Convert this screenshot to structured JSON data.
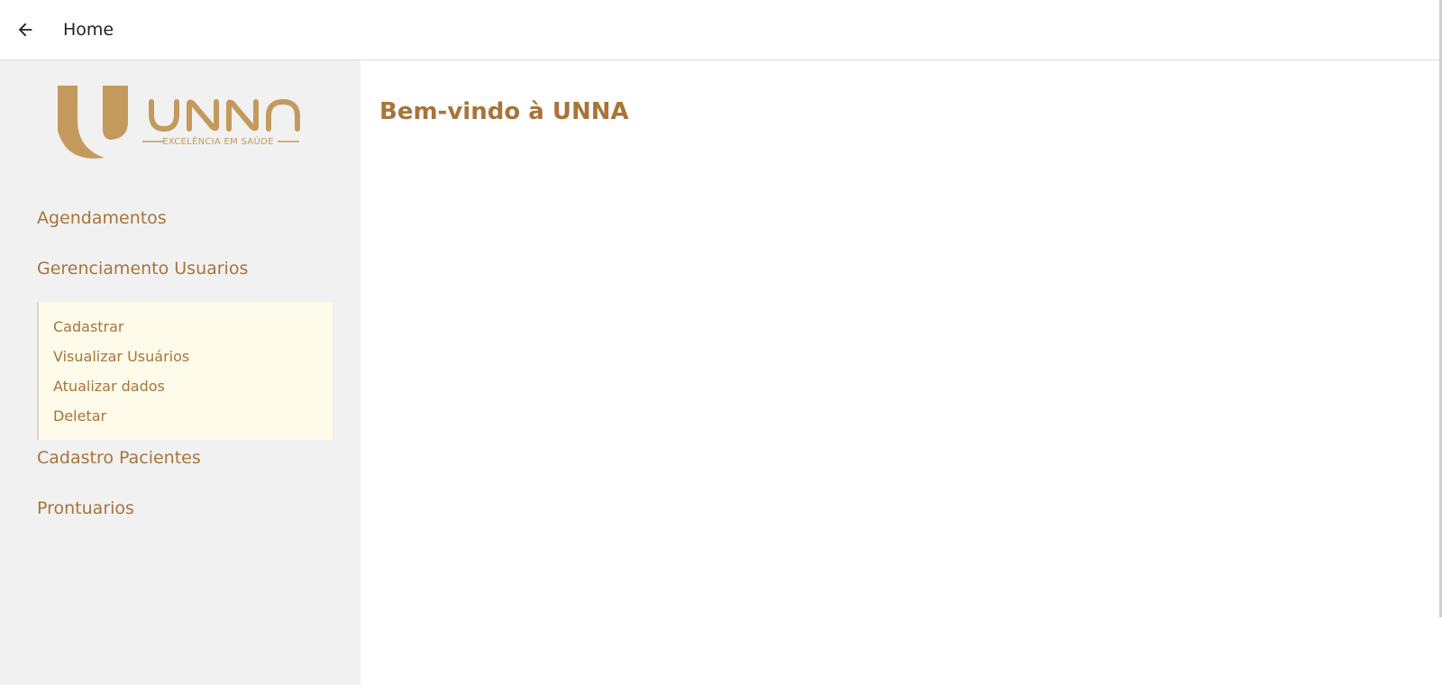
{
  "header": {
    "back_icon": "arrow-left-icon",
    "title": "Home"
  },
  "logo": {
    "wordmark": "UNNA",
    "tagline": "EXCELÊNCIA EM SAÚDE"
  },
  "sidebar": {
    "items": [
      {
        "label": "Agendamentos"
      },
      {
        "label": "Gerenciamento Usuarios",
        "expanded": true,
        "subitems": [
          {
            "label": "Cadastrar"
          },
          {
            "label": "Visualizar Usuários"
          },
          {
            "label": "Atualizar dados"
          },
          {
            "label": "Deletar"
          }
        ]
      },
      {
        "label": "Cadastro Pacientes"
      },
      {
        "label": "Prontuarios"
      }
    ]
  },
  "main": {
    "welcome": "Bem-vindo à UNNA"
  },
  "colors": {
    "brand": "#a8743a",
    "logo_gold": "#c49a5c",
    "sidebar_bg": "#f1f1f1",
    "submenu_bg": "#fffbea"
  }
}
